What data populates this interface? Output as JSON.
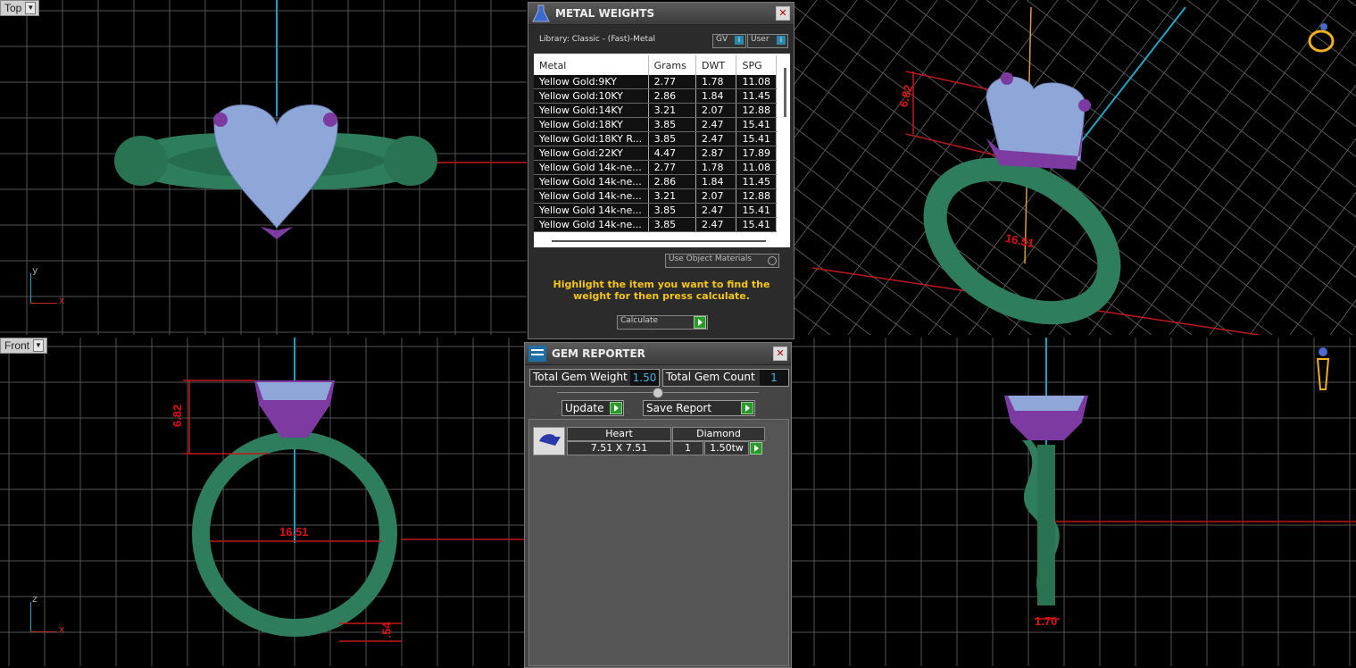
{
  "viewports": {
    "top": {
      "label": "Top"
    },
    "front": {
      "label": "Front"
    },
    "persp_dims": {
      "height": "6.82",
      "width": "16.51"
    },
    "front_dims": {
      "height": "6.82",
      "width": "16.51",
      "bottom": ".54"
    },
    "right_dims": {
      "width": "1.70"
    }
  },
  "axes": {
    "x": "x",
    "y": "y",
    "z": "z"
  },
  "metal_weights": {
    "title": "METAL WEIGHTS",
    "library": "Library: Classic - (Fast)-Metal",
    "gv_label": "GV",
    "user_label": "User",
    "columns": [
      "Metal",
      "Grams",
      "DWT",
      "SPG"
    ],
    "rows": [
      [
        "Yellow Gold:9KY",
        "2.77",
        "1.78",
        "11.08"
      ],
      [
        "Yellow Gold:10KY",
        "2.86",
        "1.84",
        "11.45"
      ],
      [
        "Yellow Gold:14KY",
        "3.21",
        "2.07",
        "12.88"
      ],
      [
        "Yellow Gold:18KY",
        "3.85",
        "2.47",
        "15.41"
      ],
      [
        "Yellow Gold:18KY R...",
        "3.85",
        "2.47",
        "15.41"
      ],
      [
        "Yellow Gold:22KY",
        "4.47",
        "2.87",
        "17.89"
      ],
      [
        "Yellow Gold 14k-ne...",
        "2.77",
        "1.78",
        "11.08"
      ],
      [
        "Yellow Gold 14k-ne...",
        "2.86",
        "1.84",
        "11.45"
      ],
      [
        "Yellow Gold 14k-ne...",
        "3.21",
        "2.07",
        "12.88"
      ],
      [
        "Yellow Gold 14k-ne...",
        "3.85",
        "2.47",
        "15.41"
      ],
      [
        "Yellow Gold 14k-ne...",
        "3.85",
        "2.47",
        "15.41"
      ]
    ],
    "use_object_materials": "Use Object Materials",
    "instruction": "Highlight the item you want to find the weight for then press calculate.",
    "calculate_label": "Calculate"
  },
  "gem_reporter": {
    "title": "GEM REPORTER",
    "total_weight_label": "Total Gem Weight",
    "total_weight_value": "1.50",
    "total_count_label": "Total Gem Count",
    "total_count_value": "1",
    "update_label": "Update",
    "save_report_label": "Save Report",
    "gem": {
      "shape": "Heart",
      "size": "7.51 X 7.51",
      "type": "Diamond",
      "count": "1",
      "weight": "1.50tw"
    }
  },
  "colors": {
    "band": "#2e7d5c",
    "gem": "#8fa6d8",
    "prong": "#7d3aa0",
    "dim": "#e01010",
    "instruction": "#f5c518"
  }
}
